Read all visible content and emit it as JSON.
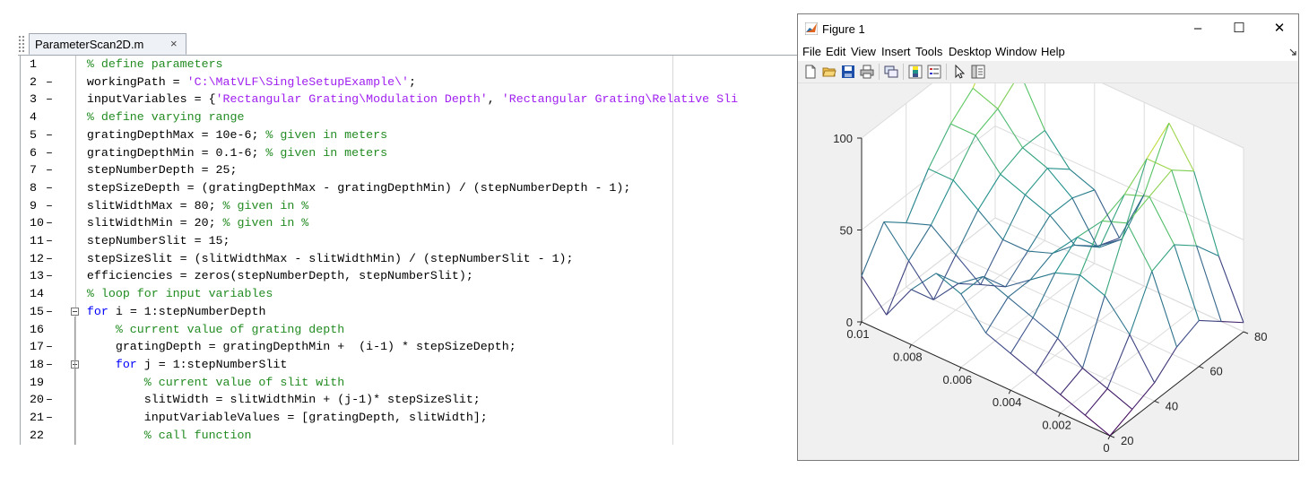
{
  "editor": {
    "tab": {
      "filename": "ParameterScan2D.m",
      "close": "×"
    },
    "lines": [
      {
        "num": "1",
        "dash": "",
        "fold": false,
        "tokens": [
          {
            "t": "    % define parameters",
            "c": "cmt"
          }
        ]
      },
      {
        "num": "2",
        "dash": "–",
        "fold": false,
        "tokens": [
          {
            "t": "    workingPath = ",
            "c": ""
          },
          {
            "t": "'C:\\MatVLF\\SingleSetupExample\\'",
            "c": "str"
          },
          {
            "t": ";",
            "c": ""
          }
        ]
      },
      {
        "num": "3",
        "dash": "–",
        "fold": false,
        "tokens": [
          {
            "t": "    inputVariables = {",
            "c": ""
          },
          {
            "t": "'Rectangular Grating\\Modulation Depth'",
            "c": "str"
          },
          {
            "t": ", ",
            "c": ""
          },
          {
            "t": "'Rectangular Grating\\Relative Sli",
            "c": "str"
          }
        ]
      },
      {
        "num": "4",
        "dash": "",
        "fold": false,
        "tokens": [
          {
            "t": "    % define varying range",
            "c": "cmt"
          }
        ]
      },
      {
        "num": "5",
        "dash": "–",
        "fold": false,
        "tokens": [
          {
            "t": "    gratingDepthMax = 10e-6; ",
            "c": ""
          },
          {
            "t": "% given in meters",
            "c": "cmt"
          }
        ]
      },
      {
        "num": "6",
        "dash": "–",
        "fold": false,
        "tokens": [
          {
            "t": "    gratingDepthMin = 0.1-6; ",
            "c": ""
          },
          {
            "t": "% given in meters",
            "c": "cmt"
          }
        ]
      },
      {
        "num": "7",
        "dash": "–",
        "fold": false,
        "tokens": [
          {
            "t": "    stepNumberDepth = 25;",
            "c": ""
          }
        ]
      },
      {
        "num": "8",
        "dash": "–",
        "fold": false,
        "tokens": [
          {
            "t": "    stepSizeDepth = (gratingDepthMax - gratingDepthMin) / (stepNumberDepth - 1);",
            "c": ""
          }
        ]
      },
      {
        "num": "9",
        "dash": "–",
        "fold": false,
        "tokens": [
          {
            "t": "    slitWidthMax = 80; ",
            "c": ""
          },
          {
            "t": "% given in %",
            "c": "cmt"
          }
        ]
      },
      {
        "num": "10",
        "dash": "–",
        "fold": false,
        "tokens": [
          {
            "t": "    slitWidthMin = 20; ",
            "c": ""
          },
          {
            "t": "% given in %",
            "c": "cmt"
          }
        ]
      },
      {
        "num": "11",
        "dash": "–",
        "fold": false,
        "tokens": [
          {
            "t": "    stepNumberSlit = 15;",
            "c": ""
          }
        ]
      },
      {
        "num": "12",
        "dash": "–",
        "fold": false,
        "tokens": [
          {
            "t": "    stepSizeSlit = (slitWidthMax - slitWidthMin) / (stepNumberSlit - 1);",
            "c": ""
          }
        ]
      },
      {
        "num": "13",
        "dash": "–",
        "fold": false,
        "tokens": [
          {
            "t": "    efficiencies = zeros(stepNumberDepth, stepNumberSlit);",
            "c": ""
          }
        ]
      },
      {
        "num": "14",
        "dash": "",
        "fold": false,
        "tokens": [
          {
            "t": "    % loop for input variables",
            "c": "cmt"
          }
        ]
      },
      {
        "num": "15",
        "dash": "–",
        "fold": true,
        "tokens": [
          {
            "t": "    ",
            "c": ""
          },
          {
            "t": "for",
            "c": "kw"
          },
          {
            "t": " i = 1:stepNumberDepth",
            "c": ""
          }
        ]
      },
      {
        "num": "16",
        "dash": "",
        "fold": false,
        "tokens": [
          {
            "t": "        % current value of grating depth",
            "c": "cmt"
          }
        ]
      },
      {
        "num": "17",
        "dash": "–",
        "fold": false,
        "tokens": [
          {
            "t": "        gratingDepth = gratingDepthMin +  (i-1) * stepSizeDepth;",
            "c": ""
          }
        ]
      },
      {
        "num": "18",
        "dash": "–",
        "fold": true,
        "tokens": [
          {
            "t": "        ",
            "c": ""
          },
          {
            "t": "for",
            "c": "kw"
          },
          {
            "t": " j = 1:stepNumberSlit",
            "c": ""
          }
        ]
      },
      {
        "num": "19",
        "dash": "",
        "fold": false,
        "tokens": [
          {
            "t": "            % current value of slit with",
            "c": "cmt"
          }
        ]
      },
      {
        "num": "20",
        "dash": "–",
        "fold": false,
        "tokens": [
          {
            "t": "            slitWidth = slitWidthMin + (j-1)* stepSizeSlit;",
            "c": ""
          }
        ]
      },
      {
        "num": "21",
        "dash": "–",
        "fold": false,
        "tokens": [
          {
            "t": "            inputVariableValues = [gratingDepth, slitWidth];",
            "c": ""
          }
        ]
      },
      {
        "num": "22",
        "dash": "",
        "fold": false,
        "tokens": [
          {
            "t": "            % call function",
            "c": "cmt"
          }
        ]
      }
    ]
  },
  "figure": {
    "title": "Figure 1",
    "window_buttons": {
      "minimize": "–",
      "maximize": "☐",
      "close": "✕"
    },
    "menu": [
      "File",
      "Edit",
      "View",
      "Insert",
      "Tools",
      "Desktop",
      "Window",
      "Help"
    ],
    "toolbar_icons": [
      "new-figure-icon",
      "open-file-icon",
      "save-icon",
      "print-icon",
      "link-plot-icon",
      "insert-colorbar-icon",
      "insert-legend-icon",
      "edit-plot-icon",
      "property-inspector-icon"
    ],
    "colors": {
      "low": "#440154",
      "mid": "#21918c",
      "high": "#fde725"
    }
  },
  "chart_data": {
    "type": "mesh",
    "title": "",
    "xlabel": "",
    "ylabel": "",
    "zlabel": "",
    "x_ticks": [
      "0.01",
      "0.008",
      "0.006",
      "0.004",
      "0.002",
      "0"
    ],
    "y_ticks": [
      "20",
      "40",
      "60",
      "80"
    ],
    "z_ticks": [
      "0",
      "50",
      "100"
    ],
    "xlim": [
      0,
      0.01
    ],
    "ylim": [
      20,
      80
    ],
    "zlim": [
      0,
      100
    ],
    "grid": true,
    "x": [
      0.01,
      0.009,
      0.008,
      0.007,
      0.006,
      0.005,
      0.004,
      0.003,
      0.002,
      0.001,
      0
    ],
    "y": [
      20,
      30,
      40,
      50,
      60,
      70,
      80
    ],
    "z": [
      [
        25,
        45,
        35,
        55,
        70,
        80,
        100
      ],
      [
        10,
        30,
        40,
        55,
        70,
        75,
        85
      ],
      [
        30,
        15,
        30,
        45,
        55,
        60,
        60
      ],
      [
        45,
        30,
        20,
        35,
        50,
        55,
        45
      ],
      [
        40,
        40,
        25,
        35,
        45,
        45,
        40
      ],
      [
        25,
        35,
        35,
        40,
        35,
        25,
        20
      ],
      [
        20,
        30,
        45,
        55,
        40,
        35,
        50
      ],
      [
        15,
        25,
        50,
        70,
        75,
        85,
        95
      ],
      [
        10,
        15,
        45,
        75,
        80,
        85,
        75
      ],
      [
        5,
        10,
        30,
        55,
        60,
        50,
        35
      ],
      [
        0,
        5,
        10,
        20,
        25,
        15,
        5
      ]
    ]
  }
}
